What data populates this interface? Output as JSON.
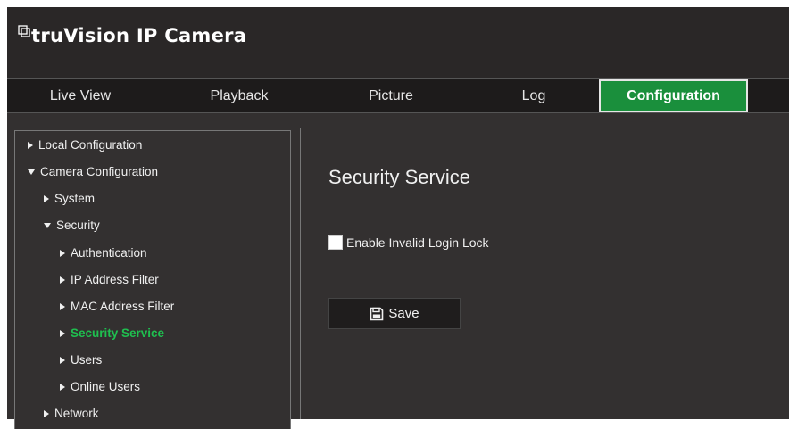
{
  "app": {
    "logo_text": "truVision IP Camera"
  },
  "nav": {
    "tabs": [
      {
        "label": "Live View"
      },
      {
        "label": "Playback"
      },
      {
        "label": "Picture"
      },
      {
        "label": "Log"
      },
      {
        "label": "Configuration",
        "active": true
      }
    ]
  },
  "sidebar": {
    "items": [
      {
        "label": "Local Configuration",
        "state": "collapsed"
      },
      {
        "label": "Camera Configuration",
        "state": "expanded"
      },
      {
        "label": "System",
        "state": "collapsed"
      },
      {
        "label": "Security",
        "state": "expanded"
      },
      {
        "label": "Authentication",
        "state": "collapsed"
      },
      {
        "label": "IP Address Filter",
        "state": "collapsed"
      },
      {
        "label": "MAC Address Filter",
        "state": "collapsed"
      },
      {
        "label": "Security Service",
        "state": "collapsed",
        "selected": true
      },
      {
        "label": "Users",
        "state": "collapsed"
      },
      {
        "label": "Online Users",
        "state": "collapsed"
      },
      {
        "label": "Network",
        "state": "collapsed"
      }
    ]
  },
  "main": {
    "title": "Security Service",
    "enable_invalid_login_lock": {
      "label": "Enable Invalid Login Lock",
      "checked": false
    },
    "save_label": "Save"
  },
  "colors": {
    "accent_green": "#1a8f3c",
    "selected_text_green": "#1fbf4f",
    "background": "#333030",
    "header": "#2a2727"
  }
}
